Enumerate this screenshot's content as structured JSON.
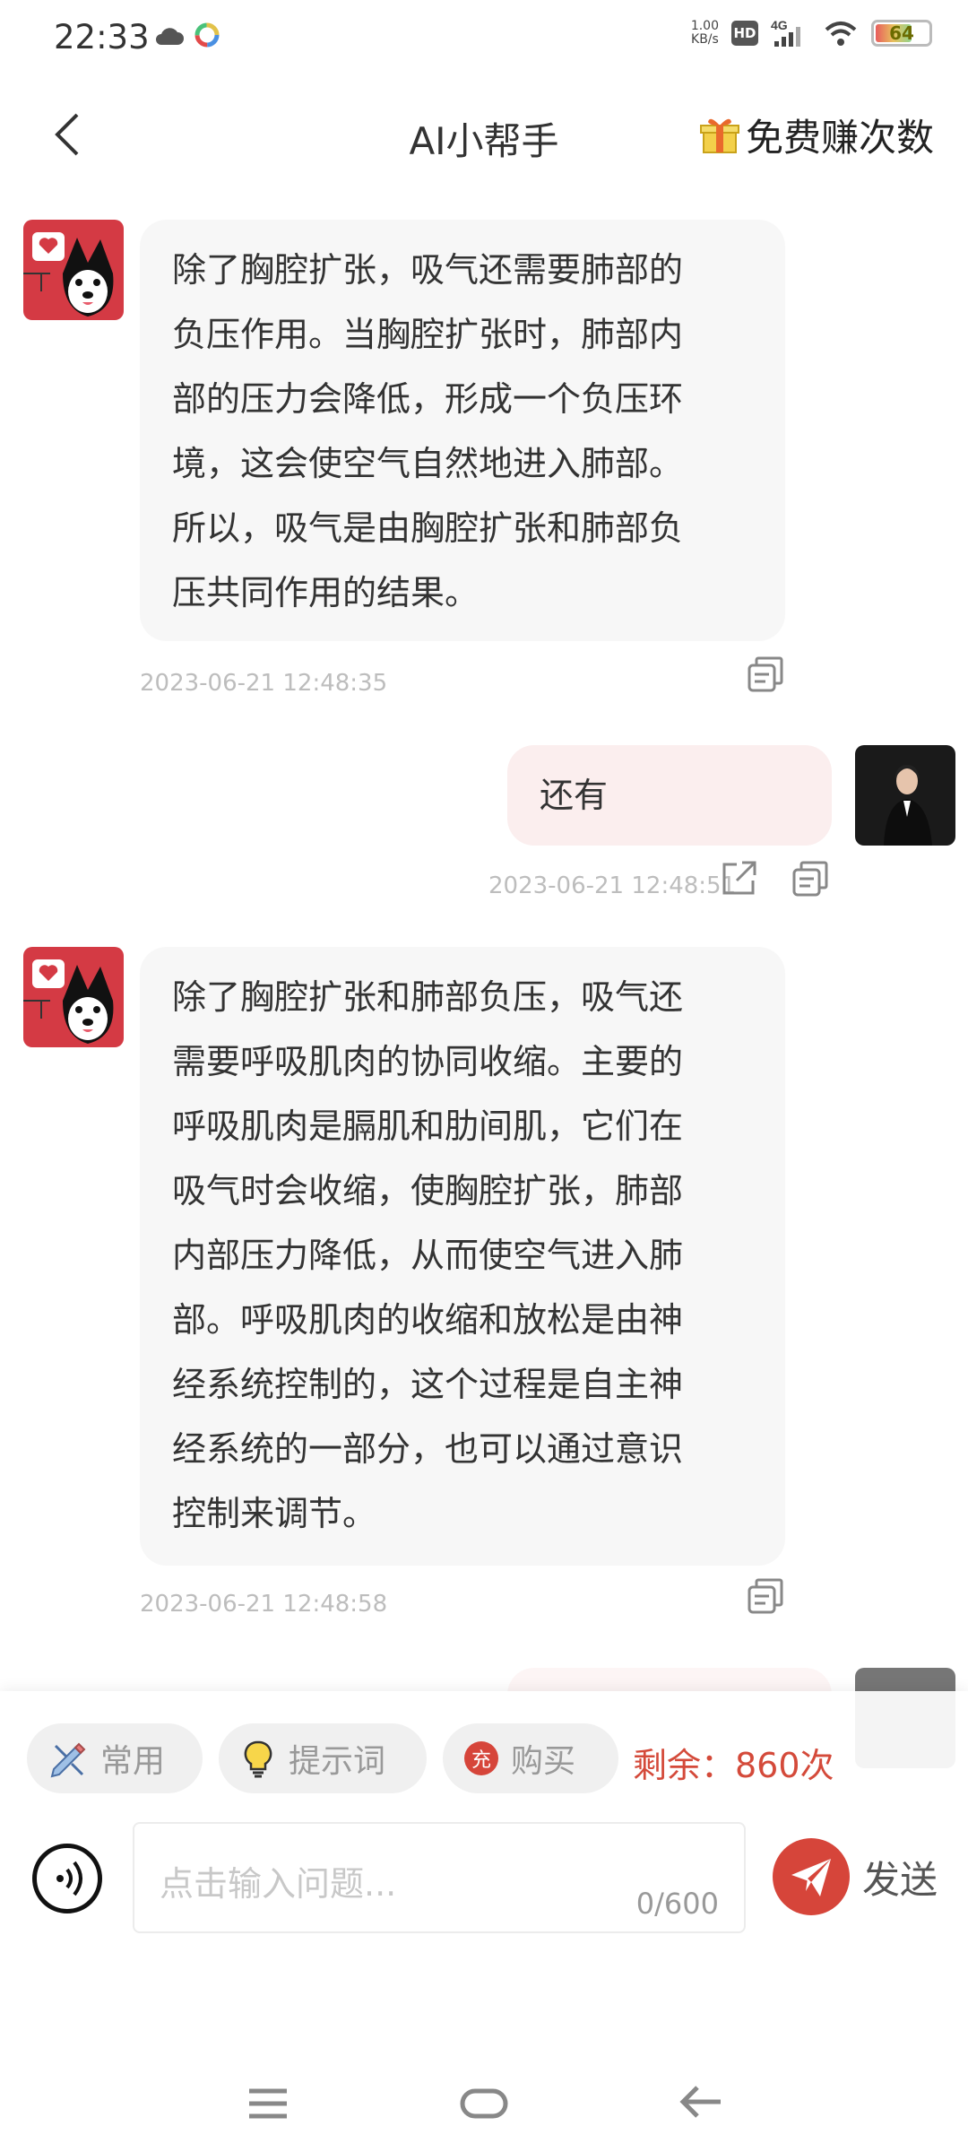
{
  "status": {
    "time": "22:33",
    "net_speed_value": "1.00",
    "net_speed_unit": "KB/s",
    "hd": "HD",
    "signal": "4G",
    "battery": "64",
    "battery_level": 0.64
  },
  "header": {
    "title": "AI小帮手",
    "earn_label": "免费赚次数"
  },
  "messages": [
    {
      "role": "bot",
      "lines": [
        "除了胸腔扩张，吸气还需要肺部的",
        "负压作用。当胸腔扩张时，肺部内",
        "部的压力会降低，形成一个负压环",
        "境，这会使空气自然地进入肺部。",
        "所以，吸气是由胸腔扩张和肺部负",
        "压共同作用的结果。"
      ],
      "time": "2023-06-21 12:48:35"
    },
    {
      "role": "user",
      "text": "还有",
      "time": "2023-06-21 12:48:51"
    },
    {
      "role": "bot",
      "lines": [
        "除了胸腔扩张和肺部负压，吸气还",
        "需要呼吸肌肉的协同收缩。主要的",
        "呼吸肌肉是膈肌和肋间肌，它们在",
        "吸气时会收缩，使胸腔扩张，肺部",
        "内部压力降低，从而使空气进入肺",
        "部。呼吸肌肉的收缩和放松是由神",
        "经系统控制的，这个过程是自主神",
        "经系统的一部分，也可以通过意识",
        "控制来调节。"
      ],
      "time": "2023-06-21 12:48:58"
    }
  ],
  "toolbar": {
    "common_label": "常用",
    "prompt_label": "提示词",
    "buy_badge": "充",
    "buy_label": "购买",
    "remaining": "剩余：860次"
  },
  "composer": {
    "placeholder": "点击输入问题...",
    "count": "0/600",
    "send_label": "发送"
  },
  "colors": {
    "accent": "#d6453a",
    "user_bubble": "#fbeeee",
    "bot_bubble": "#f7f7f7"
  }
}
